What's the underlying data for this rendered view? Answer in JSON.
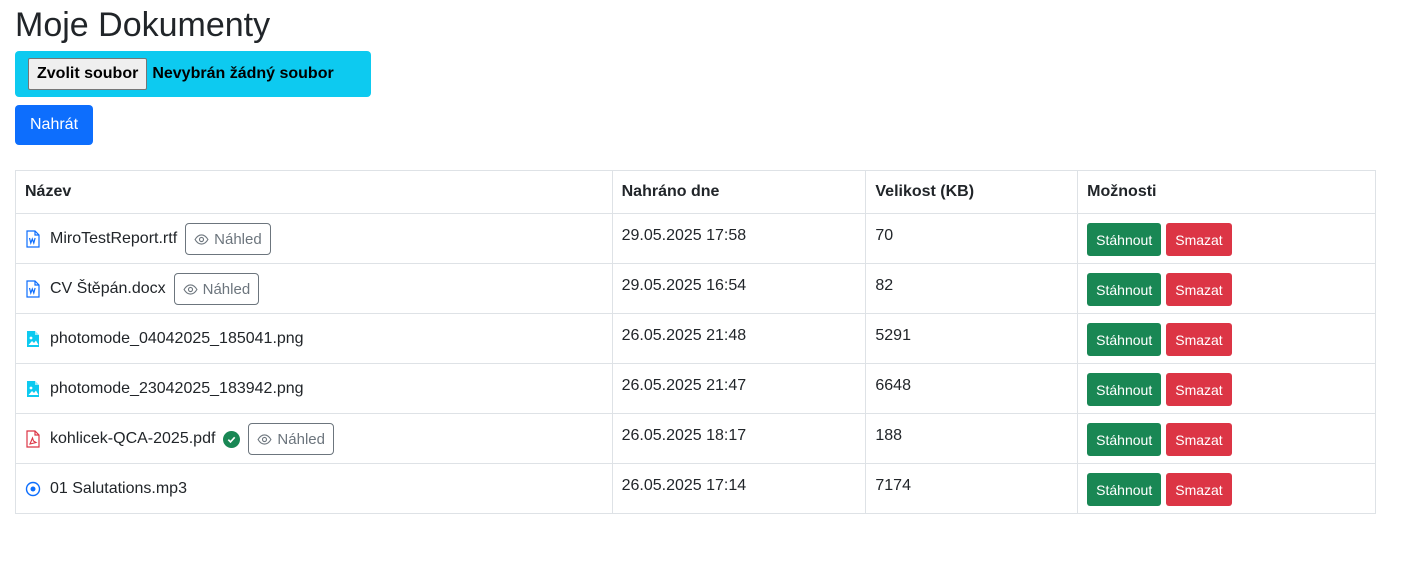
{
  "page": {
    "title": "Moje Dokumenty"
  },
  "upload": {
    "choose_label": "Zvolit soubor",
    "status": "Nevybrán žádný soubor",
    "submit_label": "Nahrát"
  },
  "table": {
    "headers": [
      "Název",
      "Nahráno dne",
      "Velikost (KB)",
      "Možnosti"
    ],
    "preview_label": "Náhled",
    "download_label": "Stáhnout",
    "delete_label": "Smazat",
    "rows": [
      {
        "name": "MiroTestReport.rtf",
        "icon": "word-file-icon",
        "preview": true,
        "verified": false,
        "date": "29.05.2025 17:58",
        "size": "70"
      },
      {
        "name": "CV Štěpán.docx",
        "icon": "word-file-icon",
        "preview": true,
        "verified": false,
        "date": "29.05.2025 16:54",
        "size": "82"
      },
      {
        "name": "photomode_04042025_185041.png",
        "icon": "image-file-icon",
        "preview": false,
        "verified": false,
        "date": "26.05.2025 21:48",
        "size": "5291"
      },
      {
        "name": "photomode_23042025_183942.png",
        "icon": "image-file-icon",
        "preview": false,
        "verified": false,
        "date": "26.05.2025 21:47",
        "size": "6648"
      },
      {
        "name": "kohlicek-QCA-2025.pdf",
        "icon": "pdf-file-icon",
        "preview": true,
        "verified": true,
        "date": "26.05.2025 18:17",
        "size": "188"
      },
      {
        "name": "01 Salutations.mp3",
        "icon": "audio-file-icon",
        "preview": false,
        "verified": false,
        "date": "26.05.2025 17:14",
        "size": "7174"
      }
    ]
  },
  "colors": {
    "primary": "#0d6efd",
    "info": "#0dcaf0",
    "success": "#198754",
    "danger": "#dc3545",
    "secondary": "#6c757d"
  }
}
